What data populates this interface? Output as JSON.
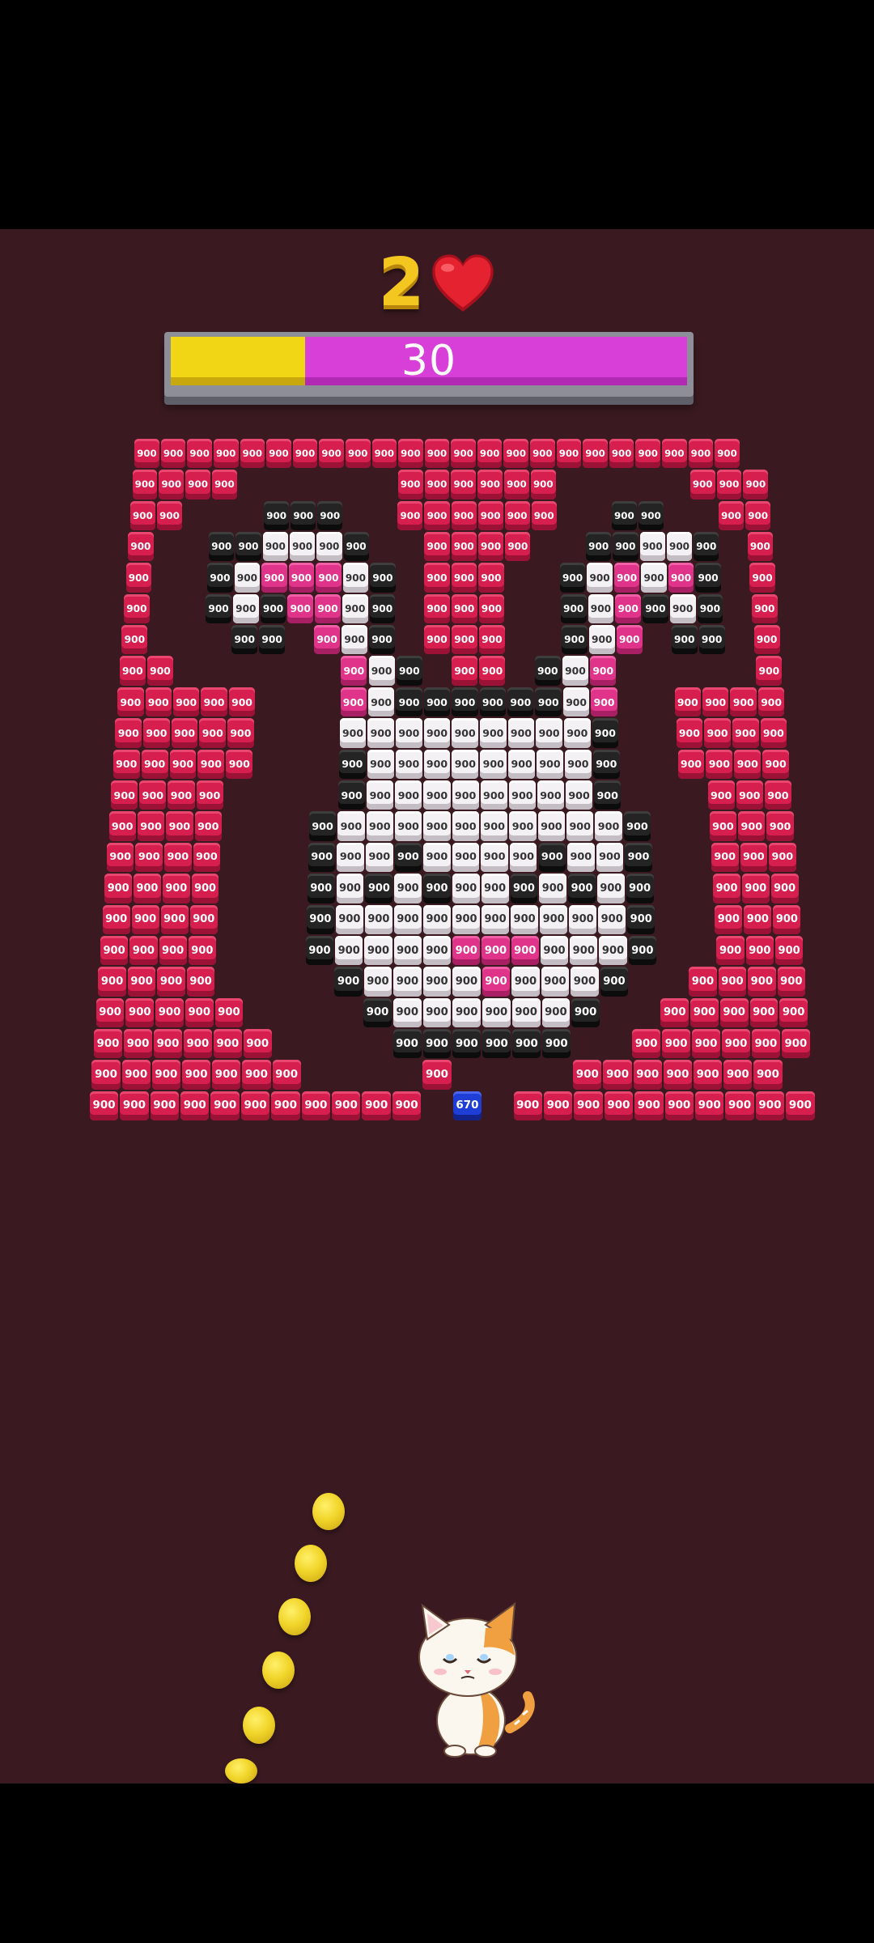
{
  "hud": {
    "level": "2",
    "heart_icon": "heart-icon",
    "progress_value": "30",
    "progress_fraction": 0.26
  },
  "colors": {
    "background": "#3a1a20",
    "red_brick": "#d71f4f",
    "white_brick": "#f4f1f4",
    "black_brick": "#242424",
    "pink_brick": "#e0338a",
    "blue_brick": "#1f3ed6",
    "progress_fill": "#f0d615",
    "progress_track": "#d83fd8",
    "ball": "#f1d52a"
  },
  "bricks": {
    "value": "900",
    "special_value": "670",
    "rows": [
      "..rrrrrrrrrrrrrrrrrrrrrrr..",
      "..rrrr......rrrrrr.....rrr.",
      "..rr...kkk..rrrrrr..kk..rr.",
      "..r..kkwwwk..rrrr..kkwwk.r.",
      "..r..kwpppwk.rrr..kwpwpk.r.",
      "..r..kwkppwk.rrr..kwpkwk.r.",
      "..r...kk.pwk.rrr..kwp.kk.r.",
      "..rr......pwk.rr.kwp.....r.",
      "..rrrrr...pwkkkkkkwp..rrrr.",
      "..rrrrr...wwwwwwwwwk..rrrr.",
      "..rrrrr...kwwwwwwwwk..rrrr.",
      "..rrrr....kwwwwwwwwk...rrr.",
      "..rrrr...kwwwwwwwwwwk..rrr.",
      "..rrrr...kwwkwwwwkwwk..rrr.",
      "..rrrr...kwkwkwwkwkwk..rrr.",
      "..rrrr...kwwwwwwwwwwk..rrr.",
      "..rrrr...kwwwwpppwwwk..rrr.",
      "..rrrr....kwwwwpwwwk..rrrr.",
      "..rrrrr....kwwwwwwk..rrrrr.",
      "..rrrrrr....kkkkkk..rrrrrr.",
      "..rrrrrrr....r....rrrrrrr..",
      "..rrrrrrrrrrr.b.rrrrrrrrrr."
    ],
    "special_position": "row 22, col 15"
  },
  "balls_visible": 6,
  "cat_icon": "cat-avatar-icon"
}
